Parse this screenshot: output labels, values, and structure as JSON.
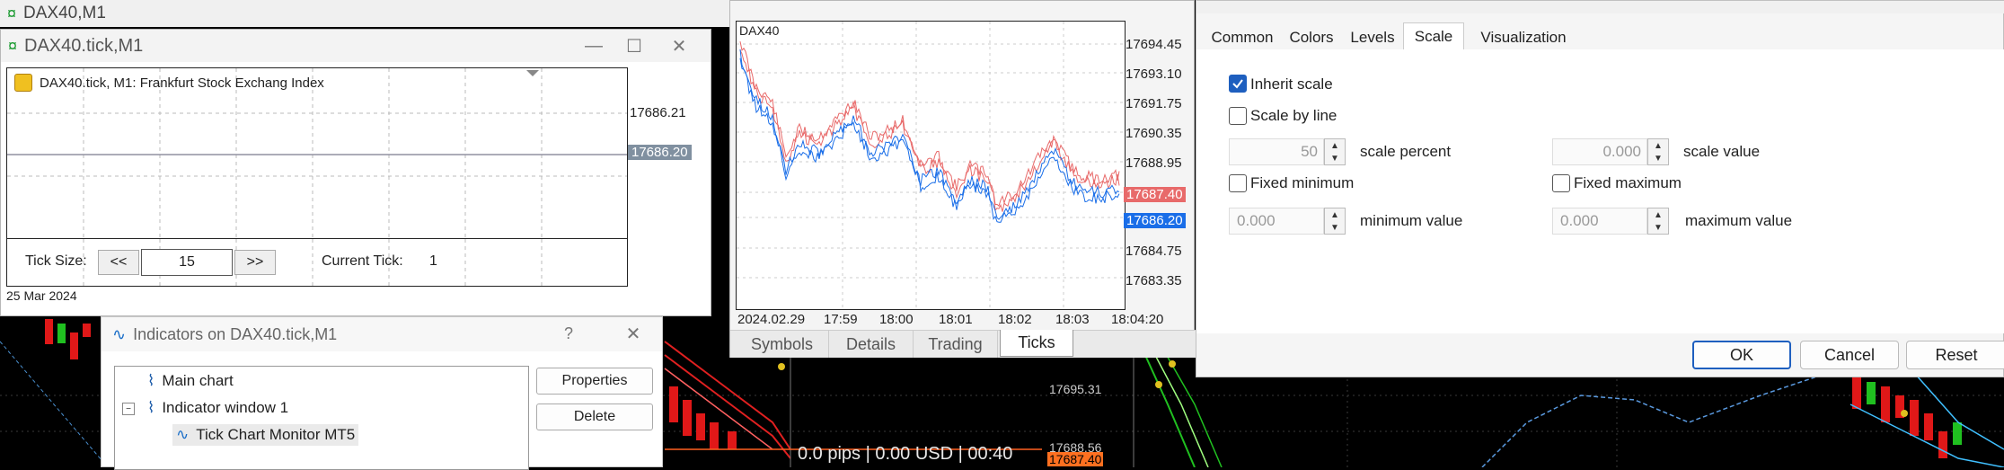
{
  "bg_window": {
    "title": "DAX40,M1"
  },
  "tick_window": {
    "title": "DAX40.tick,M1",
    "chart_label": "DAX40.tick, M1:  Frankfurt Stock Exchang Index",
    "price_top": "17686.21",
    "price_current": "17686.20",
    "date_label": "25 Mar 2024",
    "tick_size_label": "Tick Size:",
    "prev_label": "<<",
    "tick_size_value": "15",
    "next_label": ">>",
    "current_tick_label": "Current Tick:",
    "current_tick_value": "1"
  },
  "indicators_dialog": {
    "title": "Indicators on DAX40.tick,M1",
    "help": "?",
    "tree": [
      "Main chart",
      "Indicator window 1",
      "Tick Chart Monitor MT5"
    ],
    "properties_label": "Properties",
    "delete_label": "Delete"
  },
  "bottom_status": {
    "text": "0.0 pips | 0.00 USD | 00:40",
    "price_1": "17695.31",
    "price_2": "17688.56",
    "price_3": "17687.40"
  },
  "tick_chart": {
    "symbol": "DAX40",
    "price_labels": [
      "17694.45",
      "17693.10",
      "17691.75",
      "17690.35",
      "17688.95",
      "17687.40",
      "17686.20",
      "17684.75",
      "17683.35"
    ],
    "ask_label": "17687.40",
    "bid_label": "17686.20",
    "time_labels": [
      "2024.02.29",
      "17:59",
      "18:00",
      "18:01",
      "18:02",
      "18:03",
      "18:04:20"
    ],
    "tabs": [
      "Symbols",
      "Details",
      "Trading",
      "Ticks"
    ],
    "active_tab": "Ticks"
  },
  "colors": {
    "ask": "#e86a6a",
    "bid": "#1a6ee8",
    "accent": "#1e5fbf"
  },
  "properties_dialog": {
    "tabs": [
      "Common",
      "Colors",
      "Levels",
      "Scale",
      "Visualization"
    ],
    "active_tab": "Scale",
    "inherit_scale": "Inherit scale",
    "scale_by_line": "Scale by line",
    "scale_percent_value": "50",
    "scale_percent_label": "scale percent",
    "scale_value_value": "0.000",
    "scale_value_label": "scale value",
    "fixed_minimum": "Fixed minimum",
    "fixed_maximum": "Fixed maximum",
    "minimum_value_value": "0.000",
    "minimum_value_label": "minimum value",
    "maximum_value_value": "0.000",
    "maximum_value_label": "maximum value",
    "ok": "OK",
    "cancel": "Cancel",
    "reset": "Reset"
  }
}
